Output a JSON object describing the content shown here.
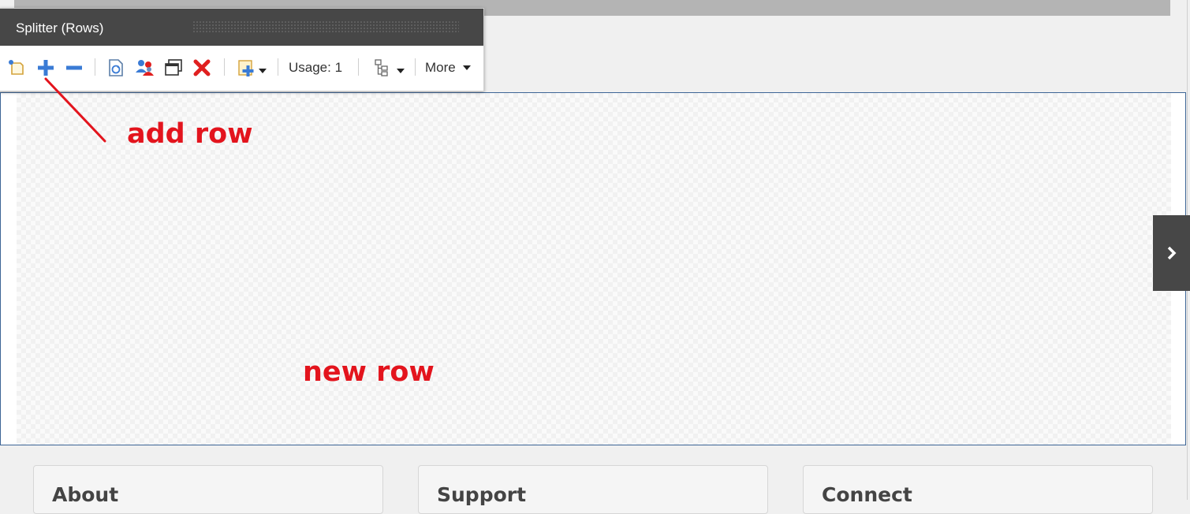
{
  "toolbar": {
    "title": "Splitter (Rows)",
    "usage_label": "Usage: 1",
    "more_label": "More",
    "icons": [
      "new-item-icon",
      "add-row-icon",
      "remove-row-icon",
      "refresh-icon",
      "users-icon",
      "window-icon",
      "delete-icon",
      "insert-icon",
      "tree-icon"
    ]
  },
  "annotations": {
    "add_row": "add row",
    "new_row": "new row",
    "color": "#e3141d"
  },
  "footer": {
    "cards": [
      {
        "title": "About"
      },
      {
        "title": "Support"
      },
      {
        "title": "Connect"
      }
    ]
  },
  "colors": {
    "toolbar_header": "#474747",
    "accent_blue": "#3a7bd5",
    "delete_red": "#e02020",
    "frame_border": "#3d6596"
  }
}
